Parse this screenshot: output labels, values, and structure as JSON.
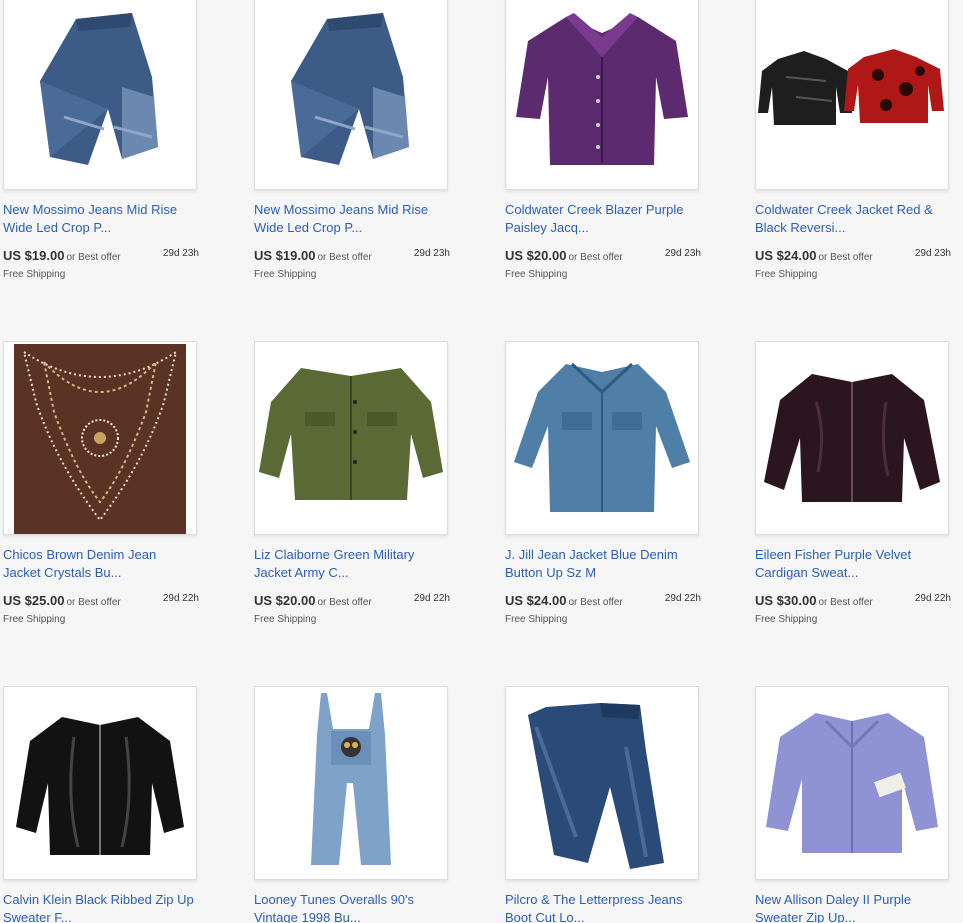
{
  "listings": [
    {
      "title_line1": "New Mossimo Jeans Mid Rise",
      "title_line2": "Wide Led Crop P...",
      "price": "US $19.00",
      "offer": "or Best offer",
      "time_left": "29d 23h",
      "shipping": "Free Shipping",
      "image_icon": "jeans-cropped-icon"
    },
    {
      "title_line1": "New Mossimo Jeans Mid Rise",
      "title_line2": "Wide Led Crop P...",
      "price": "US $19.00",
      "offer": "or Best offer",
      "time_left": "29d 23h",
      "shipping": "Free Shipping",
      "image_icon": "jeans-cropped-icon"
    },
    {
      "title_line1": "Coldwater Creek Blazer Purple",
      "title_line2": "Paisley Jacq...",
      "price": "US $20.00",
      "offer": "or Best offer",
      "time_left": "29d 23h",
      "shipping": "Free Shipping",
      "image_icon": "purple-blazer-icon"
    },
    {
      "title_line1": "Coldwater Creek Jacket Red &",
      "title_line2": "Black Reversi...",
      "price": "US $24.00",
      "offer": "or Best offer",
      "time_left": "29d 23h",
      "shipping": "Free Shipping",
      "image_icon": "reversible-jackets-icon"
    },
    {
      "title_line1": "Chicos Brown Denim Jean",
      "title_line2": "Jacket Crystals Bu...",
      "price": "US $25.00",
      "offer": "or Best offer",
      "time_left": "29d 22h",
      "shipping": "Free Shipping",
      "image_icon": "crystal-denim-icon"
    },
    {
      "title_line1": "Liz Claiborne Green Military",
      "title_line2": "Jacket Army C...",
      "price": "US $20.00",
      "offer": "or Best offer",
      "time_left": "29d 22h",
      "shipping": "Free Shipping",
      "image_icon": "green-jacket-icon"
    },
    {
      "title_line1": "J. Jill Jean Jacket Blue Denim",
      "title_line2": "Button Up Sz M",
      "price": "US $24.00",
      "offer": "or Best offer",
      "time_left": "29d 22h",
      "shipping": "Free Shipping",
      "image_icon": "denim-jacket-icon"
    },
    {
      "title_line1": "Eileen Fisher Purple Velvet",
      "title_line2": "Cardigan Sweat...",
      "price": "US $30.00",
      "offer": "or Best offer",
      "time_left": "29d 22h",
      "shipping": "Free Shipping",
      "image_icon": "velvet-cardigan-icon"
    },
    {
      "title_line1": "Calvin Klein Black Ribbed Zip Up",
      "title_line2": "Sweater F...",
      "price": "",
      "offer": "",
      "time_left": "",
      "shipping": "",
      "image_icon": "black-sweater-icon"
    },
    {
      "title_line1": "Looney Tunes Overalls 90's",
      "title_line2": "Vintage 1998 Bu...",
      "price": "",
      "offer": "",
      "time_left": "",
      "shipping": "",
      "image_icon": "overalls-icon"
    },
    {
      "title_line1": "Pilcro & The Letterpress Jeans",
      "title_line2": "Boot Cut Lo...",
      "price": "",
      "offer": "",
      "time_left": "",
      "shipping": "",
      "image_icon": "bootcut-jeans-icon"
    },
    {
      "title_line1": "New Allison Daley II Purple",
      "title_line2": "Sweater Zip Up...",
      "price": "",
      "offer": "",
      "time_left": "",
      "shipping": "",
      "image_icon": "purple-sweater-icon"
    }
  ]
}
